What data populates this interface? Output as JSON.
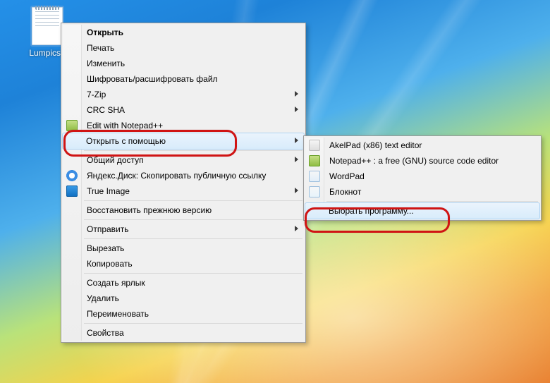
{
  "desktop": {
    "file_label": "Lumpics.t"
  },
  "main_menu": {
    "open": "Открыть",
    "print": "Печать",
    "edit": "Изменить",
    "encrypt": "Шифровать/расшифровать файл",
    "sevenzip": "7-Zip",
    "crcsha": "CRC SHA",
    "edit_npp": "Edit with Notepad++",
    "open_with": "Открыть с помощью",
    "sharing": "Общий доступ",
    "yadisk": "Яндекс.Диск: Скопировать публичную ссылку",
    "true_image": "True Image",
    "restore": "Восстановить прежнюю версию",
    "send_to": "Отправить",
    "cut": "Вырезать",
    "copy": "Копировать",
    "shortcut": "Создать ярлык",
    "delete": "Удалить",
    "rename": "Переименовать",
    "properties": "Свойства"
  },
  "sub_menu": {
    "akelpad": "AkelPad (x86) text editor",
    "notepadpp": "Notepad++ : a free (GNU) source code editor",
    "wordpad": "WordPad",
    "notepad": "Блокнот",
    "choose": "Выбрать программу..."
  }
}
